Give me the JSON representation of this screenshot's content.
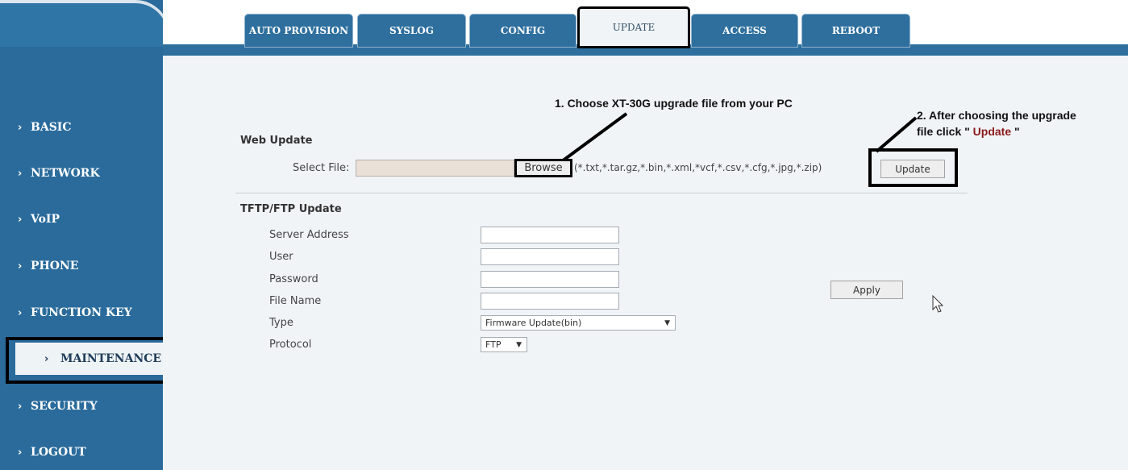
{
  "sidebar": {
    "items": [
      {
        "label": "BASIC"
      },
      {
        "label": "NETWORK"
      },
      {
        "label": "VoIP"
      },
      {
        "label": "PHONE"
      },
      {
        "label": "FUNCTION KEY"
      },
      {
        "label": "MAINTENANCE"
      },
      {
        "label": "SECURITY"
      },
      {
        "label": "LOGOUT"
      }
    ],
    "chevron": "›"
  },
  "tabs": [
    {
      "label": "AUTO PROVISION"
    },
    {
      "label": "SYSLOG"
    },
    {
      "label": "CONFIG"
    },
    {
      "label": "UPDATE"
    },
    {
      "label": "ACCESS"
    },
    {
      "label": "REBOOT"
    }
  ],
  "web_update": {
    "title": "Web Update",
    "select_file_label": "Select File:",
    "browse_label": "Browse",
    "file_types": "(*.txt,*.tar.gz,*.bin,*.xml,*vcf,*.csv,*.cfg,*.jpg,*.zip)",
    "update_label": "Update"
  },
  "tftp": {
    "title": "TFTP/FTP Update",
    "server_address_label": "Server Address",
    "user_label": "User",
    "password_label": "Password",
    "file_name_label": "File Name",
    "type_label": "Type",
    "protocol_label": "Protocol",
    "type_value": "Firmware Update(bin)",
    "protocol_value": "FTP",
    "apply_label": "Apply"
  },
  "annotations": {
    "step1": "1. Choose XT-30G upgrade file from your PC",
    "step2_line1": "2. After choosing the upgrade",
    "step2_line2_prefix": "file click \" ",
    "step2_highlight": "Update",
    "step2_line2_suffix": " \""
  },
  "colors": {
    "sidebar": "#2a6b9b",
    "tab": "#2e6f9e",
    "content_bg": "#f1f4f7",
    "highlight_text": "#8a1a1a"
  }
}
